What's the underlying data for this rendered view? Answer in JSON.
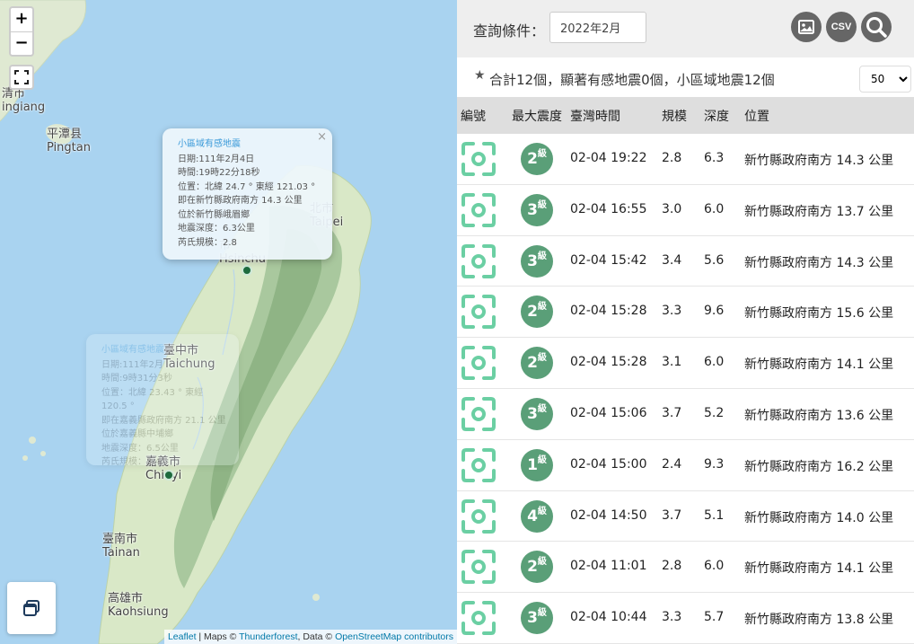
{
  "map": {
    "zoom_in": "+",
    "zoom_out": "−",
    "labels": [
      {
        "id": "kinmen",
        "zh": "清市",
        "en": "ingiang"
      },
      {
        "id": "pingtan",
        "zh": "平潭县",
        "en": "Pingtan"
      },
      {
        "id": "taipei",
        "zh": "北市",
        "en": "Taipei"
      },
      {
        "id": "hsinchu",
        "zh": "市",
        "en": "Hsinchu"
      },
      {
        "id": "taichung",
        "zh": "臺中市",
        "en": "Taichung"
      },
      {
        "id": "chiayi",
        "zh": "嘉義市",
        "en": "Chiayi"
      },
      {
        "id": "tainan",
        "zh": "臺南市",
        "en": "Tainan"
      },
      {
        "id": "kaohsiung",
        "zh": "高雄市",
        "en": "Kaohsiung"
      }
    ],
    "popup_main": {
      "title": "小區域有感地震",
      "close": "×",
      "lines": [
        "日期:111年2月4日",
        "時間:19時22分18秒",
        "位置：北緯 24.7 ° 東經 121.03 °",
        "即在新竹縣政府南方 14.3 公里",
        "位於新竹縣峨眉鄉",
        "地震深度：6.3公里",
        "芮氏規模：2.8"
      ]
    },
    "popup_faded": {
      "title": "小區域有感地震",
      "lines": [
        "日期:111年2月",
        "時間:9時31分3秒",
        "位置：北緯 23.43 ° 東經 120.5 °",
        "即在嘉義縣政府南方 21.1 公里",
        "位於嘉義縣中埔鄉",
        "地震深度：6.5公里",
        "芮氏規模：3.4"
      ]
    },
    "attribution": {
      "leaflet": "Leaflet",
      "sep1": " | Maps © ",
      "thunderforest": "Thunderforest",
      "sep2": ", Data © ",
      "osm": "OpenStreetMap contributors"
    }
  },
  "toolbar": {
    "query_label": "查詢條件：",
    "query_value": "2022年2月",
    "csv_label": "CSV"
  },
  "summary": {
    "text": "合計12個，顯著有感地震0個，小區域地震12個",
    "page_size": "50"
  },
  "table": {
    "headers": [
      "編號",
      "最大震度",
      "臺灣時間",
      "規模",
      "深度",
      "位置"
    ],
    "intensity_suffix": "級",
    "rows": [
      {
        "intensity": "2",
        "time": "02-04 19:22",
        "mag": "2.8",
        "depth": "6.3",
        "loc": "新竹縣政府南方 14.3 公里"
      },
      {
        "intensity": "3",
        "time": "02-04 16:55",
        "mag": "3.0",
        "depth": "6.0",
        "loc": "新竹縣政府南方 13.7 公里"
      },
      {
        "intensity": "3",
        "time": "02-04 15:42",
        "mag": "3.4",
        "depth": "5.6",
        "loc": "新竹縣政府南方 14.3 公里"
      },
      {
        "intensity": "2",
        "time": "02-04 15:28",
        "mag": "3.3",
        "depth": "9.6",
        "loc": "新竹縣政府南方 15.6 公里"
      },
      {
        "intensity": "2",
        "time": "02-04 15:28",
        "mag": "3.1",
        "depth": "6.0",
        "loc": "新竹縣政府南方 14.1 公里"
      },
      {
        "intensity": "3",
        "time": "02-04 15:06",
        "mag": "3.7",
        "depth": "5.2",
        "loc": "新竹縣政府南方 13.6 公里"
      },
      {
        "intensity": "1",
        "time": "02-04 15:00",
        "mag": "2.4",
        "depth": "9.3",
        "loc": "新竹縣政府南方 16.2 公里"
      },
      {
        "intensity": "4",
        "time": "02-04 14:50",
        "mag": "3.7",
        "depth": "5.1",
        "loc": "新竹縣政府南方 14.0 公里"
      },
      {
        "intensity": "2",
        "time": "02-04 11:01",
        "mag": "2.8",
        "depth": "6.0",
        "loc": "新竹縣政府南方 14.1 公里"
      },
      {
        "intensity": "3",
        "time": "02-04 10:44",
        "mag": "3.3",
        "depth": "5.7",
        "loc": "新竹縣政府南方 13.8 公里"
      }
    ]
  },
  "colors": {
    "sea": "#a9d3f0",
    "land": "#d9e8c7",
    "mountain": "#9bbf94",
    "badge": "#5a9f78",
    "focus_icon": "#6bcfa3",
    "toolbar_button": "#666666",
    "popup_title": "#3a9ad9",
    "marker": "#1e6b3e"
  },
  "icons": [
    "image-icon",
    "search-icon",
    "fullscreen-icon",
    "layers-icon",
    "focus-icon",
    "star-icon"
  ]
}
